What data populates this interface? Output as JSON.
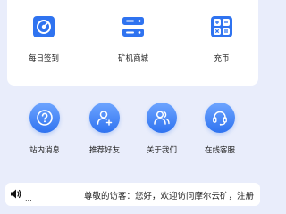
{
  "top_menu": {
    "items": [
      {
        "label": "每日签到",
        "icon": "dashboard-icon"
      },
      {
        "label": "矿机商城",
        "icon": "server-icon"
      },
      {
        "label": "充币",
        "icon": "calculator-icon"
      }
    ]
  },
  "circle_menu": {
    "items": [
      {
        "label": "站内消息",
        "icon": "question-icon"
      },
      {
        "label": "推荐好友",
        "icon": "add-user-icon"
      },
      {
        "label": "关于我们",
        "icon": "users-icon"
      },
      {
        "label": "在线客服",
        "icon": "headset-icon"
      }
    ]
  },
  "notice": {
    "ellipsis": "...",
    "text": "尊敬的访客：您好，欢迎访问摩尔云矿，注册"
  },
  "colors": {
    "accent": "#2f73f0",
    "page_bg": "#e9edfb"
  }
}
